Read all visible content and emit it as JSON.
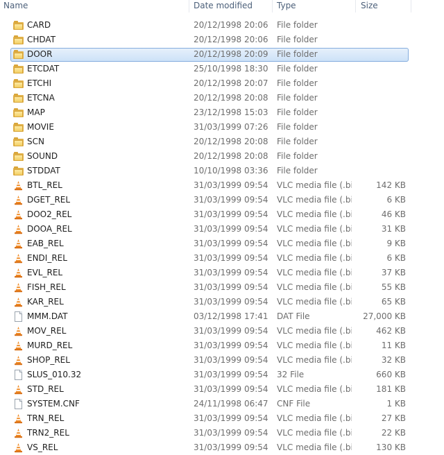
{
  "columns": {
    "name": "Name",
    "date_modified": "Date modified",
    "type": "Type",
    "size": "Size"
  },
  "colors": {
    "selection_border": "#84acdd",
    "selection_fill": "#cde2f8",
    "folder": "#f3cf64",
    "vlc_cone": "#f08a24"
  },
  "files": [
    {
      "name": "CARD",
      "date": "20/12/1998 20:06",
      "type": "File folder",
      "size": "",
      "icon": "folder-icon"
    },
    {
      "name": "CHDAT",
      "date": "20/12/1998 20:06",
      "type": "File folder",
      "size": "",
      "icon": "folder-icon"
    },
    {
      "name": "DOOR",
      "date": "20/12/1998 20:09",
      "type": "File folder",
      "size": "",
      "icon": "folder-icon",
      "selected": true
    },
    {
      "name": "ETCDAT",
      "date": "25/10/1998 18:30",
      "type": "File folder",
      "size": "",
      "icon": "folder-icon"
    },
    {
      "name": "ETCHI",
      "date": "20/12/1998 20:07",
      "type": "File folder",
      "size": "",
      "icon": "folder-icon"
    },
    {
      "name": "ETCNA",
      "date": "20/12/1998 20:08",
      "type": "File folder",
      "size": "",
      "icon": "folder-icon"
    },
    {
      "name": "MAP",
      "date": "23/12/1998 15:03",
      "type": "File folder",
      "size": "",
      "icon": "folder-icon"
    },
    {
      "name": "MOVIE",
      "date": "31/03/1999 07:26",
      "type": "File folder",
      "size": "",
      "icon": "folder-icon"
    },
    {
      "name": "SCN",
      "date": "20/12/1998 20:08",
      "type": "File folder",
      "size": "",
      "icon": "folder-icon"
    },
    {
      "name": "SOUND",
      "date": "20/12/1998 20:08",
      "type": "File folder",
      "size": "",
      "icon": "folder-icon"
    },
    {
      "name": "STDDAT",
      "date": "10/10/1998 03:36",
      "type": "File folder",
      "size": "",
      "icon": "folder-icon"
    },
    {
      "name": "BTL_REL",
      "date": "31/03/1999 09:54",
      "type": "VLC media file (.bi...",
      "size": "142 KB",
      "icon": "vlc-cone-icon"
    },
    {
      "name": "DGET_REL",
      "date": "31/03/1999 09:54",
      "type": "VLC media file (.bi...",
      "size": "6 KB",
      "icon": "vlc-cone-icon"
    },
    {
      "name": "DOO2_REL",
      "date": "31/03/1999 09:54",
      "type": "VLC media file (.bi...",
      "size": "46 KB",
      "icon": "vlc-cone-icon"
    },
    {
      "name": "DOOA_REL",
      "date": "31/03/1999 09:54",
      "type": "VLC media file (.bi...",
      "size": "31 KB",
      "icon": "vlc-cone-icon"
    },
    {
      "name": "EAB_REL",
      "date": "31/03/1999 09:54",
      "type": "VLC media file (.bi...",
      "size": "9 KB",
      "icon": "vlc-cone-icon"
    },
    {
      "name": "ENDI_REL",
      "date": "31/03/1999 09:54",
      "type": "VLC media file (.bi...",
      "size": "6 KB",
      "icon": "vlc-cone-icon"
    },
    {
      "name": "EVL_REL",
      "date": "31/03/1999 09:54",
      "type": "VLC media file (.bi...",
      "size": "37 KB",
      "icon": "vlc-cone-icon"
    },
    {
      "name": "FISH_REL",
      "date": "31/03/1999 09:54",
      "type": "VLC media file (.bi...",
      "size": "55 KB",
      "icon": "vlc-cone-icon"
    },
    {
      "name": "KAR_REL",
      "date": "31/03/1999 09:54",
      "type": "VLC media file (.bi...",
      "size": "65 KB",
      "icon": "vlc-cone-icon"
    },
    {
      "name": "MMM.DAT",
      "date": "03/12/1998 17:41",
      "type": "DAT File",
      "size": "27,000 KB",
      "icon": "blank-file-icon"
    },
    {
      "name": "MOV_REL",
      "date": "31/03/1999 09:54",
      "type": "VLC media file (.bi...",
      "size": "462 KB",
      "icon": "vlc-cone-icon"
    },
    {
      "name": "MURD_REL",
      "date": "31/03/1999 09:54",
      "type": "VLC media file (.bi...",
      "size": "11 KB",
      "icon": "vlc-cone-icon"
    },
    {
      "name": "SHOP_REL",
      "date": "31/03/1999 09:54",
      "type": "VLC media file (.bi...",
      "size": "32 KB",
      "icon": "vlc-cone-icon"
    },
    {
      "name": "SLUS_010.32",
      "date": "31/03/1999 09:54",
      "type": "32 File",
      "size": "660 KB",
      "icon": "blank-file-icon"
    },
    {
      "name": "STD_REL",
      "date": "31/03/1999 09:54",
      "type": "VLC media file (.bi...",
      "size": "181 KB",
      "icon": "vlc-cone-icon"
    },
    {
      "name": "SYSTEM.CNF",
      "date": "24/11/1998 06:47",
      "type": "CNF File",
      "size": "1 KB",
      "icon": "blank-file-icon"
    },
    {
      "name": "TRN_REL",
      "date": "31/03/1999 09:54",
      "type": "VLC media file (.bi...",
      "size": "27 KB",
      "icon": "vlc-cone-icon"
    },
    {
      "name": "TRN2_REL",
      "date": "31/03/1999 09:54",
      "type": "VLC media file (.bi...",
      "size": "22 KB",
      "icon": "vlc-cone-icon"
    },
    {
      "name": "VS_REL",
      "date": "31/03/1999 09:54",
      "type": "VLC media file (.bi...",
      "size": "130 KB",
      "icon": "vlc-cone-icon"
    }
  ]
}
